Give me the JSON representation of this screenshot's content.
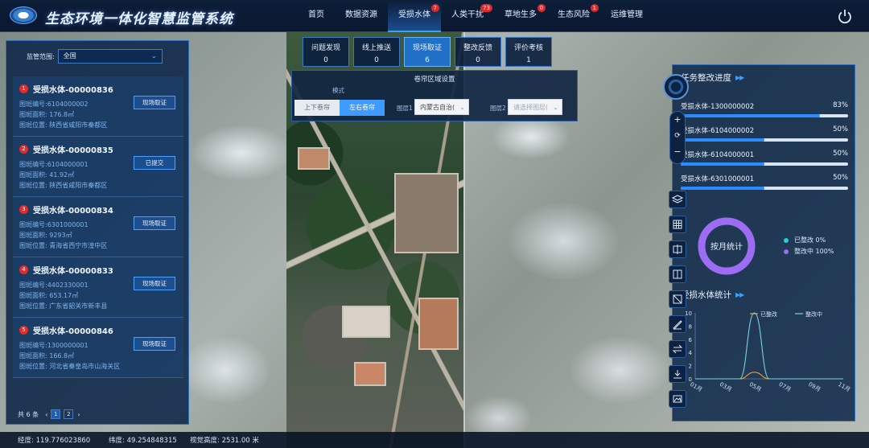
{
  "header": {
    "title": "生态环境一体化智慧监管系统",
    "nav": [
      {
        "label": "首页",
        "badge": ""
      },
      {
        "label": "数据资源",
        "badge": ""
      },
      {
        "label": "受损水体",
        "badge": "7"
      },
      {
        "label": "人类干扰",
        "badge": "73"
      },
      {
        "label": "草地生多",
        "badge": "0"
      },
      {
        "label": "生态风险",
        "badge": "1"
      },
      {
        "label": "运维管理",
        "badge": ""
      }
    ]
  },
  "left": {
    "scope_label": "监管范围:",
    "scope_value": "全国",
    "cards": [
      {
        "no": "1",
        "title": "受损水体-00000836",
        "code": "图斑编号:6104000002",
        "area": "图斑面积: 176.8㎡",
        "loc": "图斑位置: 陕西省咸阳市秦都区",
        "btn": "现场取证"
      },
      {
        "no": "2",
        "title": "受损水体-00000835",
        "code": "图斑编号:6104000001",
        "area": "图斑面积: 41.92㎡",
        "loc": "图斑位置: 陕西省咸阳市秦都区",
        "btn": "已提交"
      },
      {
        "no": "3",
        "title": "受损水体-00000834",
        "code": "图斑编号:6301000001",
        "area": "图斑面积: 9293㎡",
        "loc": "图斑位置: 青海省西宁市湟中区",
        "btn": "现场取证"
      },
      {
        "no": "4",
        "title": "受损水体-00000833",
        "code": "图斑编号:4402330001",
        "area": "图斑面积: 653.17㎡",
        "loc": "图斑位置: 广东省韶关市新丰县",
        "btn": "现场取证"
      },
      {
        "no": "5",
        "title": "受损水体-00000846",
        "code": "图斑编号:1300000001",
        "area": "图斑面积: 166.8㎡",
        "loc": "图斑位置: 河北省秦皇岛市山海关区",
        "btn": "现场取证"
      }
    ],
    "total": "共 6 条",
    "pages": [
      "1",
      "2"
    ]
  },
  "tabs": [
    {
      "label": "问题发现",
      "count": "0"
    },
    {
      "label": "线上推送",
      "count": "0"
    },
    {
      "label": "现场取证",
      "count": "6"
    },
    {
      "label": "整改反馈",
      "count": "0"
    },
    {
      "label": "评价考核",
      "count": "1"
    }
  ],
  "swipe": {
    "title": "卷帘区域设置",
    "mode_label": "模式",
    "mode_updown": "上下卷帘",
    "mode_leftright": "左右卷帘",
    "layer1_label": "图层1",
    "layer1_value": "内蒙古自治(",
    "layer2_label": "图层2",
    "layer2_placeholder": "请选择图层("
  },
  "right": {
    "progress_title": "任务整改进度",
    "progress": [
      {
        "name": "受损水体-1300000002",
        "pct": 83
      },
      {
        "name": "受损水体-6104000002",
        "pct": 50
      },
      {
        "name": "受损水体-6104000001",
        "pct": 50
      },
      {
        "name": "受损水体-6301000001",
        "pct": 50
      }
    ],
    "donut_label": "按月统计",
    "legend": [
      {
        "label": "已整改",
        "value": "0%",
        "color": "#23d2d6"
      },
      {
        "label": "整改中",
        "value": "100%",
        "color": "#9c6cf2"
      }
    ],
    "stats_title": "受损水体统计"
  },
  "chart_data": {
    "type": "line",
    "categories": [
      "01月",
      "03月",
      "05月",
      "07月",
      "09月",
      "11月"
    ],
    "x": [
      1,
      2,
      3,
      4,
      5,
      6,
      7,
      8,
      9,
      10,
      11
    ],
    "series": [
      {
        "name": "已整改",
        "color": "#f2a33a",
        "values": [
          0,
          0,
          0,
          0,
          1,
          0,
          0,
          0,
          0,
          0,
          0
        ]
      },
      {
        "name": "整改中",
        "color": "#7ad3e6",
        "values": [
          0,
          0,
          0,
          0,
          10,
          0,
          0,
          0,
          0,
          0,
          0
        ]
      }
    ],
    "ylim": [
      0,
      10
    ],
    "yticks": [
      0,
      2,
      4,
      6,
      8,
      10
    ],
    "legend_position": "top-right",
    "grid": false
  },
  "status": {
    "lng": "经度: 119.776023860",
    "lat": "纬度: 49.254848315",
    "alt": "视觉高度: 2531.00 米"
  }
}
